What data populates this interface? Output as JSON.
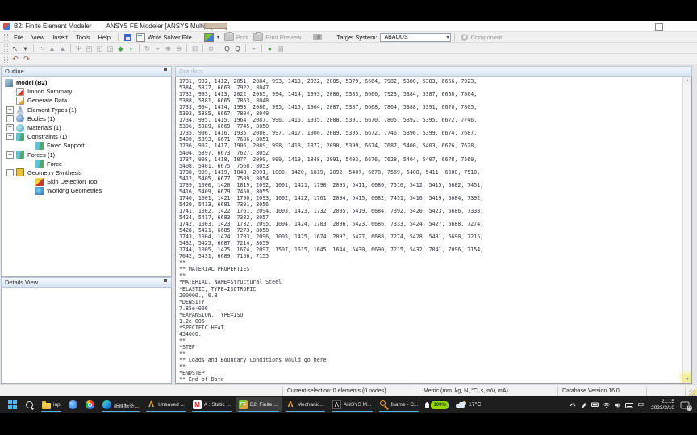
{
  "colors": {
    "panel_header_blue": "#d7e4f3",
    "highlight_yellow": "#f3ee9b",
    "taskbar_underline": "#5ab3e8",
    "ansys_gold": "#f0a81e",
    "taskbar_bg": "#1e1e1e"
  },
  "window": {
    "title_left": "B2: Finite Element Modeler",
    "title_right": "ANSYS FE Modeler [ANSYS Multiphysics]"
  },
  "menu": {
    "items": [
      "File",
      "View",
      "Insert",
      "Tools",
      "Help"
    ]
  },
  "toolbar": {
    "write_solver_label": "Write Solver File",
    "print_label": "Print",
    "print_preview_label": "Print Preview",
    "target_system_label": "Target System:",
    "target_system_value": "ABAQUS",
    "dropdown_caret": "▾",
    "component_label": "Component"
  },
  "toolbar2": {
    "icons": [
      {
        "glyph": "↖",
        "name": "select-cursor-icon",
        "color": "dk"
      },
      {
        "glyph": "▾",
        "name": "select-mode-dropdown-icon",
        "color": "dk"
      },
      {
        "sep": true
      },
      {
        "glyph": "∴",
        "name": "vertex-select-icon"
      },
      {
        "glyph": "▲",
        "name": "edge-select-icon"
      },
      {
        "glyph": "▲",
        "name": "face-select-icon"
      },
      {
        "sep": true
      },
      {
        "glyph": "Ψ",
        "name": "extend-selection-icon"
      },
      {
        "glyph": "◰",
        "name": "select-nodes-icon"
      },
      {
        "glyph": "◱",
        "name": "select-elements-icon"
      },
      {
        "glyph": "◲",
        "name": "select-bodies-icon"
      },
      {
        "glyph": "◆",
        "name": "show-mesh-icon",
        "color": "grn"
      },
      {
        "glyph": "◗",
        "name": "show-body-icon",
        "color": "grn"
      },
      {
        "sep": true
      },
      {
        "glyph": "↻",
        "name": "rotate-icon"
      },
      {
        "glyph": "+",
        "name": "pan-icon"
      },
      {
        "glyph": "⊕",
        "name": "zoom-in-icon"
      },
      {
        "glyph": "⊖",
        "name": "zoom-out-icon"
      },
      {
        "sep": true
      },
      {
        "glyph": "⊡",
        "name": "box-zoom-icon"
      },
      {
        "sep": true
      },
      {
        "glyph": "⊛",
        "name": "fit-view-icon"
      },
      {
        "sep": true
      },
      {
        "glyph": "Q",
        "name": "magnifier-icon",
        "color": "dk"
      },
      {
        "glyph": "Q",
        "name": "magnifier-window-icon",
        "color": "dk"
      },
      {
        "sep": true
      },
      {
        "glyph": "⌖",
        "name": "isometric-view-icon"
      },
      {
        "sep": true
      },
      {
        "glyph": "●",
        "name": "point-select-icon",
        "color": "grn"
      },
      {
        "glyph": "▤",
        "name": "legend-icon"
      }
    ]
  },
  "toolbar3": {
    "icons": [
      {
        "glyph": "↶",
        "name": "previous-view-icon"
      },
      {
        "glyph": "↷",
        "name": "next-view-icon"
      }
    ]
  },
  "outline": {
    "title": "Outline",
    "items": [
      {
        "label": "Model (B2)",
        "indent": 0,
        "icon": "model",
        "bold": true
      },
      {
        "label": "Import Summary",
        "indent": 1,
        "icon": "import"
      },
      {
        "label": "Generate Data",
        "indent": 1,
        "icon": "generate"
      },
      {
        "label": "Element Types (1)",
        "indent": 1,
        "icon": "element-types",
        "expand": "+"
      },
      {
        "label": "Bodies (1)",
        "indent": 1,
        "icon": "bodies",
        "expand": "+"
      },
      {
        "label": "Materials (1)",
        "indent": 1,
        "icon": "materials",
        "expand": "+"
      },
      {
        "label": "Constraints (1)",
        "indent": 1,
        "icon": "constraints",
        "expand": "−"
      },
      {
        "label": "Fixed Support",
        "indent": 2,
        "icon": "fixed-support"
      },
      {
        "label": "Forces (1)",
        "indent": 1,
        "icon": "forces",
        "expand": "−"
      },
      {
        "label": "Force",
        "indent": 2,
        "icon": "force"
      },
      {
        "label": "Geometry Synthesis",
        "indent": 1,
        "icon": "geometry-synthesis",
        "expand": "−"
      },
      {
        "label": "Skin Detection Tool",
        "indent": 2,
        "icon": "skin-detection"
      },
      {
        "label": "Working Geometries",
        "indent": 2,
        "icon": "working-geometries"
      }
    ]
  },
  "details": {
    "title": "Details View"
  },
  "graphics": {
    "title": "Graphics",
    "lines": [
      "1731, 992, 1412, 2051, 2084, 993, 1413, 2022, 2085, 5379, 6664, 7982, 5380, 5383, 6666, 7923,",
      "5384, 5377, 6663, 7922, 8047",
      "1732, 993, 1413, 2022, 2085, 994, 1414, 1993, 2086, 5383, 6666, 7923, 5384, 5387, 6668, 7864,",
      "5388, 5381, 6665, 7863, 8048",
      "1733, 994, 1414, 1993, 2086, 995, 1415, 1964, 2087, 5387, 6668, 7864, 5388, 5391, 6670, 7805,",
      "5392, 5385, 6667, 7804, 8049",
      "1734, 995, 1415, 1964, 2087, 996, 1416, 1935, 2088, 5391, 6670, 7805, 5392, 5395, 6672, 7746,",
      "5396, 5389, 6669, 7745, 8050",
      "1735, 996, 1416, 1935, 2088, 997, 1417, 1906, 2089, 5395, 6672, 7746, 5396, 5399, 6674, 7687,",
      "5400, 5393, 6671, 7686, 8051",
      "1736, 997, 1417, 1906, 2089, 998, 1418, 1877, 2090, 5399, 6674, 7687, 5400, 5403, 6676, 7628,",
      "5404, 5397, 6673, 7627, 8052",
      "1737, 998, 1418, 1877, 2090, 999, 1419, 1848, 2091, 5403, 6676, 7628, 5404, 5407, 6678, 7569,",
      "5408, 5401, 6675, 7568, 8053",
      "1738, 999, 1419, 1848, 2091, 1000, 1420, 1819, 2092, 5407, 6678, 7569, 5408, 5411, 6680, 7510,",
      "5412, 5405, 6677, 7509, 8054",
      "1739, 1000, 1420, 1819, 2092, 1001, 1421, 1790, 2093, 5411, 6680, 7510, 5412, 5415, 6682, 7451,",
      "5416, 5409, 6679, 7450, 8055",
      "1740, 1001, 1421, 1790, 2093, 1002, 1422, 1761, 2094, 5415, 6682, 7451, 5416, 5419, 6684, 7392,",
      "5420, 5413, 6681, 7391, 8056",
      "1741, 1002, 1422, 1761, 2094, 1003, 1423, 1732, 2095, 5419, 6684, 7392, 5420, 5423, 6686, 7333,",
      "5424, 5417, 6683, 7332, 8057",
      "1742, 1003, 1423, 1732, 2095, 1004, 1424, 1703, 2096, 5423, 6686, 7333, 5424, 5427, 6688, 7274,",
      "5428, 5421, 6685, 7273, 8058",
      "1743, 1004, 1424, 1703, 2096, 1005, 1425, 1674, 2097, 5427, 6688, 7274, 5428, 5431, 6690, 7215,",
      "5432, 5425, 6687, 7214, 8059",
      "1744, 1005, 1425, 1674, 2097, 1507, 1615, 1645, 1644, 5430, 6690, 7215, 5432, 7041, 7096, 7154,",
      "7042, 5431, 6689, 7156, 7155",
      "**",
      "** MATERIAL PROPERTIES",
      "**",
      "*MATERIAL, NAME=Structural Steel",
      "*ELASTIC, TYPE=ISOTROPIC",
      "200000., 0.3",
      "*DENSITY",
      "7.85e-006",
      "*EXPANSION, TYPE=ISO",
      "1.2e-005",
      "*SPECIFIC HEAT",
      "434000.",
      "**",
      "*STEP",
      "**",
      "** Loads and Boundary Conditions would go here",
      "**",
      "*ENDSTEP",
      "** End of Data"
    ]
  },
  "statusbar": {
    "selection": "Current selection: 0 elements (0 nodes)",
    "units": "Metric (mm, kg, N, °C, s, mV, mA)",
    "database": "Database Version 16.0"
  },
  "taskbar": {
    "apps": [
      {
        "name": "start",
        "icon": "start",
        "label": ""
      },
      {
        "name": "search",
        "icon": "search",
        "label": ""
      },
      {
        "name": "explorer-inp",
        "icon": "folder",
        "label": "inp",
        "open": true
      },
      {
        "name": "loop",
        "icon": "loop",
        "label": ""
      },
      {
        "name": "chrome",
        "icon": "chrome",
        "label": ""
      },
      {
        "name": "edge-newtab",
        "icon": "edge",
        "label": "新建标签...",
        "open": true
      },
      {
        "name": "ansys-unsaved",
        "icon": "ansys-gold",
        "label": "Unsaved ...",
        "open": true
      },
      {
        "name": "static-structural",
        "icon": "m-red",
        "label": "A : Static ...",
        "open": true
      },
      {
        "name": "fe-modeler",
        "icon": "fe",
        "label": "B2: Finite ...",
        "open": true,
        "active": true
      },
      {
        "name": "mechanical",
        "icon": "ansys-gold",
        "label": "Mechanic...",
        "open": true
      },
      {
        "name": "ansys-mapdl",
        "icon": "ansys-black",
        "label": "ANSYS M...",
        "open": true
      },
      {
        "name": "fname-window",
        "icon": "key",
        "label": "fname - C...",
        "open": true
      }
    ],
    "battery_label": "100%",
    "weather_label": "17°C",
    "ime": "中",
    "time": "21:15",
    "date": "2023/3/10",
    "badge": "6"
  }
}
